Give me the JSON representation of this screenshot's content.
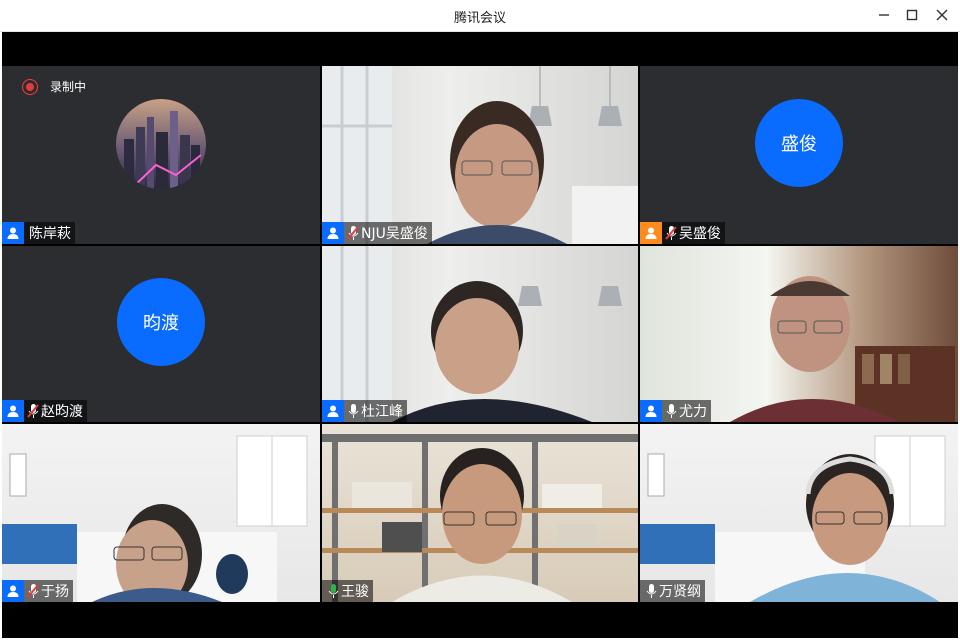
{
  "window": {
    "title": "腾讯会议",
    "controls": [
      "minimize-icon",
      "maximize-icon",
      "close-icon"
    ]
  },
  "recording": {
    "label": "录制中"
  },
  "participants": [
    {
      "name": "陈岸萩",
      "mic": "none",
      "avatar": "photo",
      "badge": "blue"
    },
    {
      "name": "NJU吴盛俊",
      "mic": "muted",
      "avatar": "video",
      "badge": "blue"
    },
    {
      "name": "吴盛俊",
      "mic": "muted",
      "avatar": "盛俊",
      "badge": "orange"
    },
    {
      "name": "赵昀渡",
      "mic": "muted",
      "avatar": "昀渡",
      "badge": "blue"
    },
    {
      "name": "杜江峰",
      "mic": "on",
      "avatar": "video",
      "badge": "blue"
    },
    {
      "name": "尤力",
      "mic": "on",
      "avatar": "video",
      "badge": "blue"
    },
    {
      "name": "于扬",
      "mic": "muted",
      "avatar": "video",
      "badge": "blue"
    },
    {
      "name": "王骏",
      "mic": "speaking",
      "avatar": "video",
      "badge": "none"
    },
    {
      "name": "万贤纲",
      "mic": "on",
      "avatar": "video",
      "badge": "none"
    }
  ],
  "colors": {
    "accent": "#0a6cff",
    "speaking": "#2fb24c",
    "muted": "#e53a3a",
    "host": "#ff8a1f"
  }
}
